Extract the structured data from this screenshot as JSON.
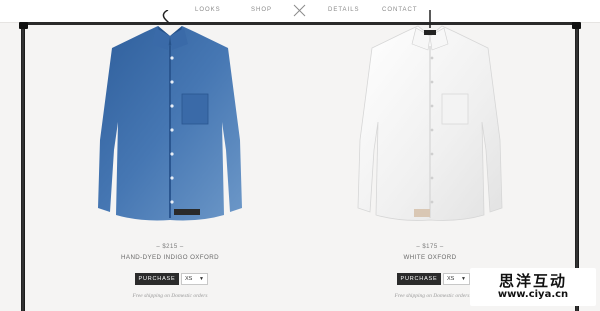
{
  "nav": {
    "items": [
      "LOOKS",
      "SHOP",
      "DETAILS",
      "CONTACT"
    ]
  },
  "products": [
    {
      "price": "– $215 –",
      "name": "HAND-DYED INDIGO OXFORD",
      "purchase_label": "PURCHASE",
      "size": "XS",
      "shipping": "Free shipping on Domestic orders",
      "color": "#3f6fa8"
    },
    {
      "price": "– $175 –",
      "name": "WHITE OXFORD",
      "purchase_label": "PURCHASE",
      "size": "XS",
      "shipping": "Free shipping on Domestic orders",
      "color": "#f2f2f2"
    }
  ],
  "watermark": {
    "title": "思洋互动",
    "url": "www.ciya.cn"
  }
}
